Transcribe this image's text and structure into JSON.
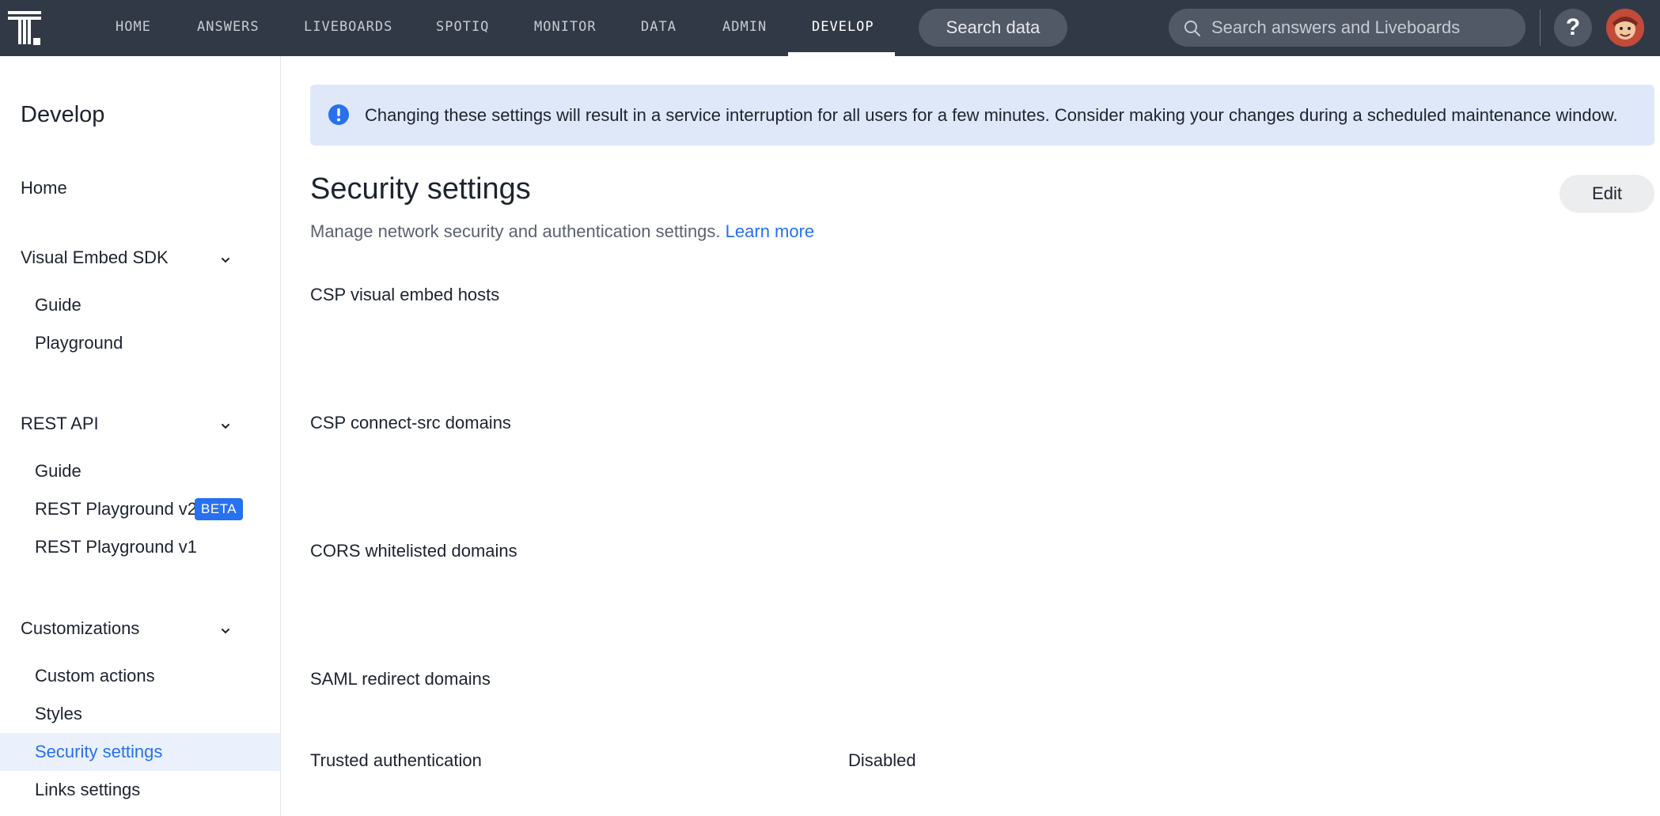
{
  "app": {
    "logo_icon": "thoughtspot-logo-icon"
  },
  "topnav": {
    "items": [
      {
        "label": "HOME",
        "active": false
      },
      {
        "label": "ANSWERS",
        "active": false
      },
      {
        "label": "LIVEBOARDS",
        "active": false
      },
      {
        "label": "SPOTIQ",
        "active": false
      },
      {
        "label": "MONITOR",
        "active": false
      },
      {
        "label": "DATA",
        "active": false
      },
      {
        "label": "ADMIN",
        "active": false
      },
      {
        "label": "DEVELOP",
        "active": true
      }
    ],
    "search_data_label": "Search data",
    "search_placeholder": "Search answers and Liveboards",
    "help_label": "?"
  },
  "sidebar": {
    "title": "Develop",
    "home_label": "Home",
    "groups": [
      {
        "label": "Visual Embed SDK",
        "items": [
          "Guide",
          "Playground"
        ]
      },
      {
        "label": "REST API",
        "items": [
          "Guide",
          "REST Playground v2",
          "REST Playground v1"
        ],
        "badge": "BETA"
      },
      {
        "label": "Customizations",
        "items": [
          "Custom actions",
          "Styles",
          "Security settings",
          "Links settings"
        ]
      }
    ],
    "active_item": "Security settings"
  },
  "banner": {
    "icon": "info-icon",
    "text": "Changing these settings will result in a service interruption for all users for a few minutes. Consider making your changes during a scheduled maintenance window."
  },
  "main": {
    "title": "Security settings",
    "subtitle": "Manage network security and authentication settings.",
    "learn_more_label": "Learn more",
    "edit_label": "Edit",
    "settings": [
      {
        "label": "CSP visual embed hosts",
        "value": ""
      },
      {
        "label": "CSP connect-src domains",
        "value": ""
      },
      {
        "label": "CORS whitelisted domains",
        "value": ""
      },
      {
        "label": "SAML redirect domains",
        "value": ""
      },
      {
        "label": "Trusted authentication",
        "value": "Disabled"
      }
    ]
  },
  "colors": {
    "nav_bg": "#323946",
    "accent": "#2770ef",
    "banner_bg": "#dfe8f8",
    "active_bg": "#eaf1fd"
  }
}
